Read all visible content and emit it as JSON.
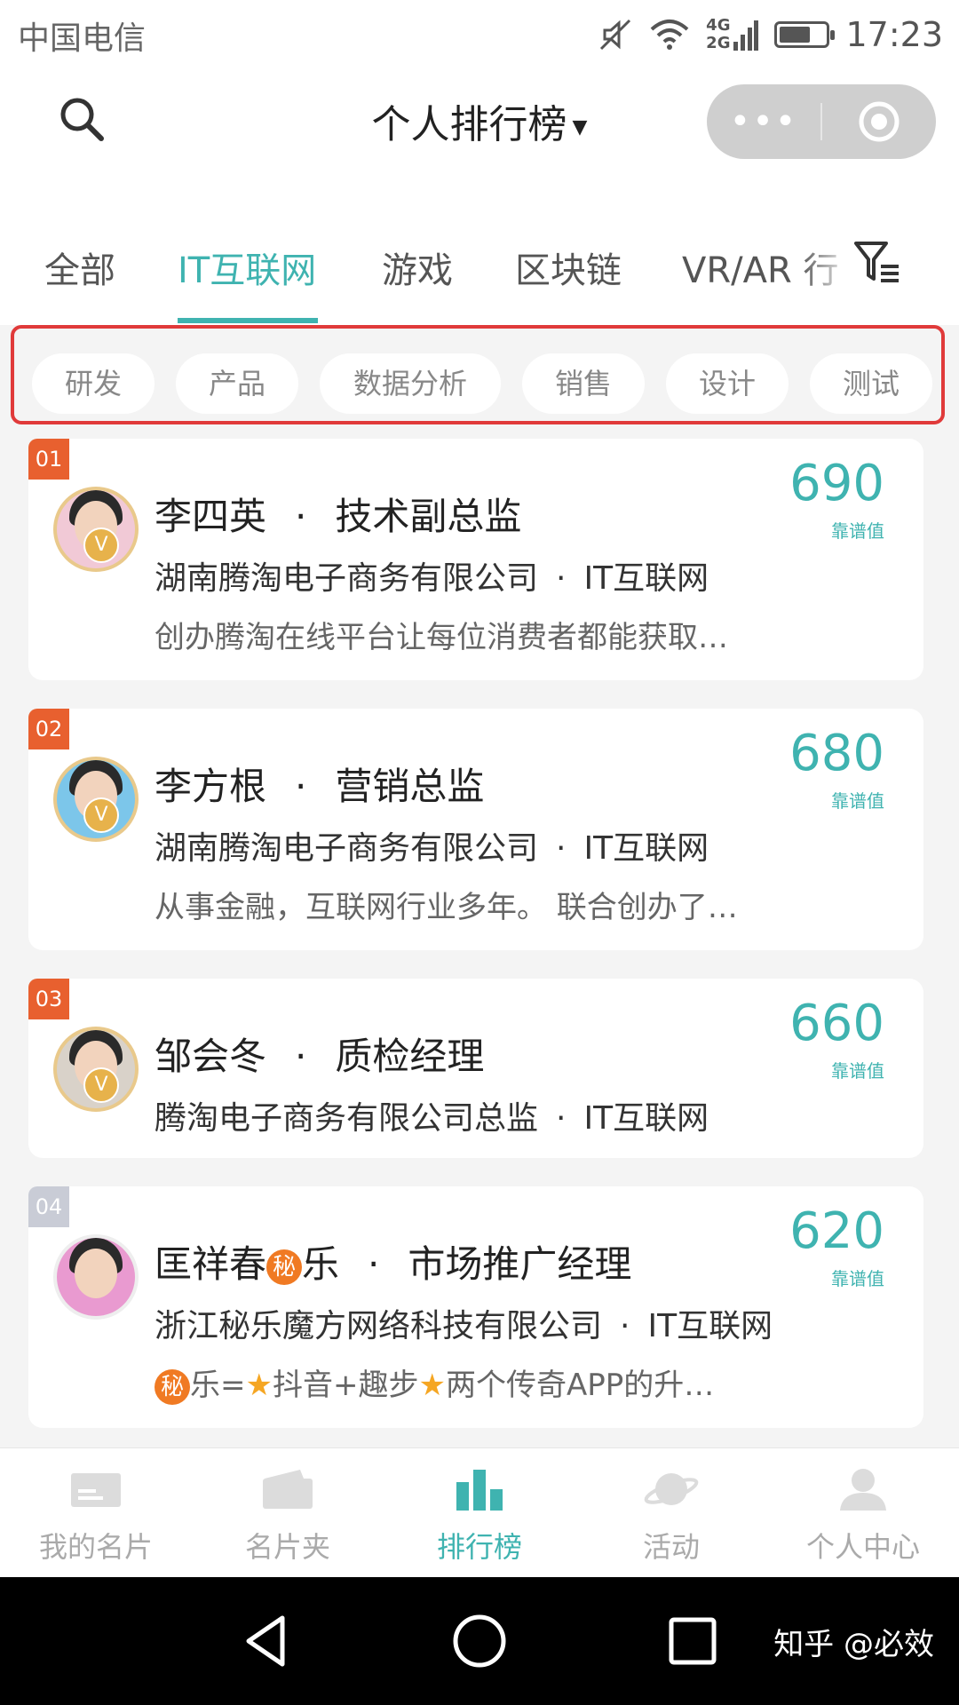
{
  "status_bar": {
    "carrier": "中国电信",
    "network_top": "4G",
    "network_bottom": "2G",
    "time": "17:23"
  },
  "header": {
    "title": "个人排行榜",
    "more_label": "•••"
  },
  "tabs": [
    {
      "label": "全部",
      "active": false
    },
    {
      "label": "IT互联网",
      "active": true
    },
    {
      "label": "游戏",
      "active": false
    },
    {
      "label": "区块链",
      "active": false
    },
    {
      "label": "VR/AR 行",
      "active": false
    }
  ],
  "sub_categories": [
    "研发",
    "产品",
    "数据分析",
    "销售",
    "设计",
    "测试"
  ],
  "score_label": "靠谱值",
  "cards": [
    {
      "rank": "01",
      "name": "李四英",
      "title": "技术副总监",
      "company": "湖南腾淘电子商务有限公司",
      "industry": "IT互联网",
      "desc": "创办腾淘在线平台让每位消费者都能获取…",
      "score": "690"
    },
    {
      "rank": "02",
      "name": "李方根",
      "title": "营销总监",
      "company": "湖南腾淘电子商务有限公司",
      "industry": "IT互联网",
      "desc": "从事金融，互联网行业多年。 联合创办了…",
      "score": "680"
    },
    {
      "rank": "03",
      "name": "邹会冬",
      "title": "质检经理",
      "company": "腾淘电子商务有限公司总监",
      "industry": "IT互联网",
      "desc": "",
      "score": "660"
    },
    {
      "rank": "04",
      "name_pre": "匡祥春",
      "name_badge": "秘",
      "name_post": "乐",
      "title": "市场推广经理",
      "company": "浙江秘乐魔方网络科技有限公司",
      "industry": "IT互联网",
      "desc_badge": "秘",
      "desc_p1": "乐=",
      "desc_p2": "抖音+趣步",
      "desc_p3": "两个传奇APP的升…",
      "score": "620"
    }
  ],
  "bottom_nav": [
    {
      "label": "我的名片",
      "icon": "card-icon",
      "active": false
    },
    {
      "label": "名片夹",
      "icon": "wallet-icon",
      "active": false
    },
    {
      "label": "排行榜",
      "icon": "bar-chart-icon",
      "active": true
    },
    {
      "label": "活动",
      "icon": "planet-icon",
      "active": false
    },
    {
      "label": "个人中心",
      "icon": "user-icon",
      "active": false
    }
  ],
  "watermark": "知乎 @必效",
  "colors": {
    "accent": "#3fb3b0",
    "rank_orange": "#e8602f",
    "highlight_border": "#e03a3a"
  }
}
